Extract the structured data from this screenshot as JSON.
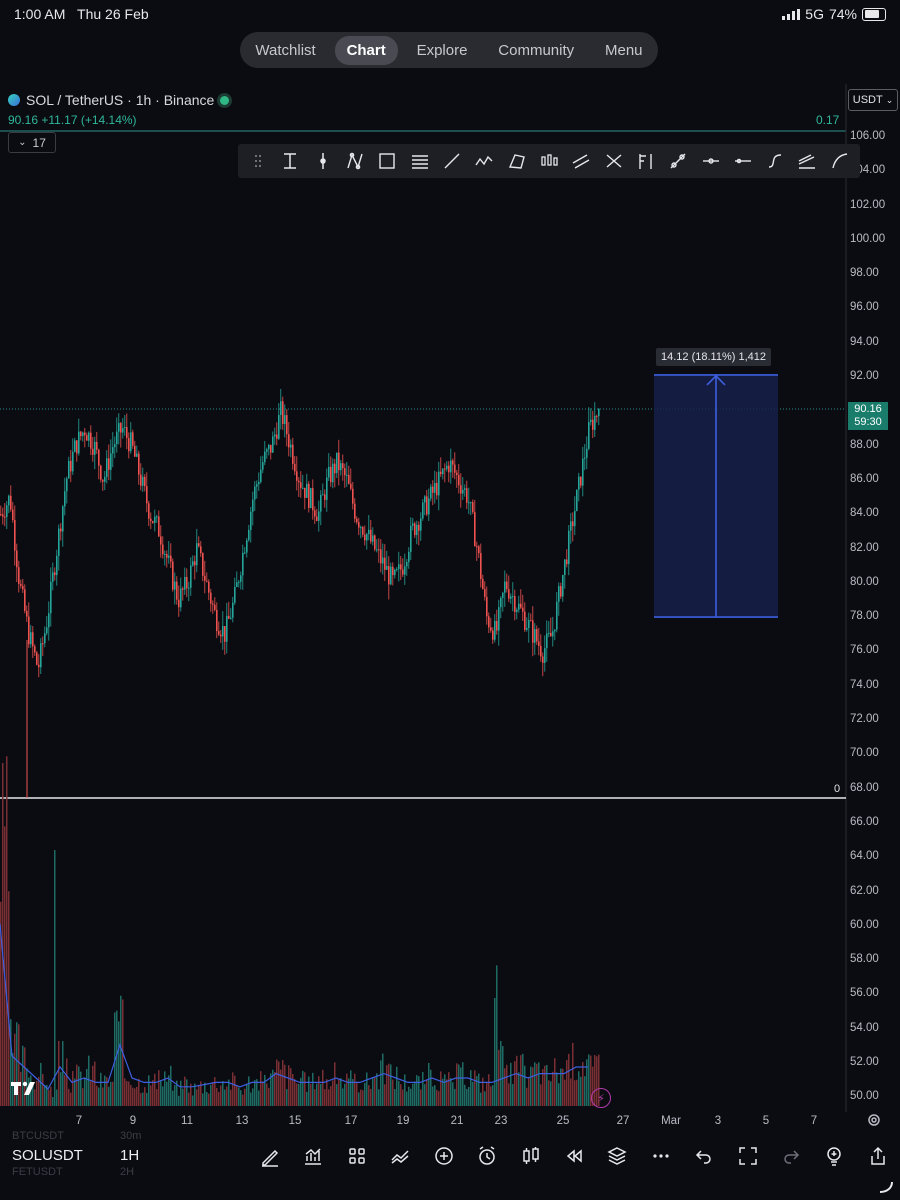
{
  "status": {
    "time": "1:00 AM",
    "date": "Thu 26 Feb",
    "network": "5G",
    "battery": "74%"
  },
  "nav": {
    "tabs": [
      "Watchlist",
      "Chart",
      "Explore",
      "Community",
      "Menu"
    ],
    "active": "Chart"
  },
  "header": {
    "symbol_line": "SOL / TetherUS · 1h · Binance",
    "price_change": "90.16 +11.17 (+14.14%)",
    "right_value": "0.17",
    "interval_value": "17",
    "quote_currency": "USDT"
  },
  "toolbar_icons": [
    "text-cursor-icon",
    "vertical-line-icon",
    "pattern-icon",
    "rectangle-icon",
    "fib-lines-icon",
    "trend-line-icon",
    "wave-icon",
    "polygon-icon",
    "candles-icon",
    "channel-icon",
    "cross-lines-icon",
    "long-position-icon",
    "anchor-icon",
    "path-icon",
    "horizontal-ray-icon",
    "horizontal-line-icon",
    "curve-icon",
    "regression-icon",
    "arc-icon"
  ],
  "axis": {
    "y_ticks": [
      "106.00",
      "104.00",
      "102.00",
      "100.00",
      "98.00",
      "96.00",
      "94.00",
      "92.00",
      "88.00",
      "86.00",
      "84.00",
      "82.00",
      "80.00",
      "78.00",
      "76.00",
      "74.00",
      "72.00",
      "70.00",
      "68.00",
      "66.00",
      "64.00",
      "62.00",
      "60.00",
      "58.00",
      "56.00",
      "54.00",
      "52.00",
      "50.00"
    ],
    "x_ticks": [
      "7",
      "9",
      "11",
      "13",
      "15",
      "17",
      "19",
      "21",
      "23",
      "25",
      "27",
      "Mar",
      "3",
      "5",
      "7"
    ]
  },
  "price_badge": {
    "price": "90.16",
    "countdown": "59:30"
  },
  "measure": {
    "label": "14.12 (18.11%) 1,412",
    "start": 78.0,
    "end": 92.12
  },
  "pane_separator_value": "0",
  "chart_data": {
    "type": "line",
    "series": [
      {
        "values": [
          84,
          85,
          80,
          77,
          75,
          78,
          82,
          86,
          88,
          89,
          88,
          86,
          88,
          89,
          88,
          86,
          84,
          83,
          81,
          79,
          80,
          82,
          80,
          78,
          77,
          79,
          82,
          85,
          87,
          88,
          90,
          88,
          86,
          85,
          84,
          86,
          87,
          86,
          84,
          83,
          82,
          81,
          80,
          81,
          83,
          84,
          85,
          86,
          87,
          86,
          85,
          82,
          78,
          77,
          80,
          79,
          78,
          77,
          76,
          77,
          80,
          83,
          86,
          89,
          90.16
        ]
      }
    ],
    "current_price": 90.16,
    "ylim": [
      50,
      106
    ],
    "volume": [
      80,
      20,
      15,
      10,
      10,
      5,
      15,
      8,
      10,
      12,
      8,
      8,
      25,
      10,
      8,
      8,
      8,
      10,
      6,
      8,
      6,
      7,
      8,
      8,
      8,
      6,
      8,
      8,
      10,
      12,
      10,
      8,
      8,
      10,
      8,
      10,
      8,
      8,
      8,
      10,
      12,
      10,
      8,
      8,
      8,
      10,
      8,
      8,
      10,
      10,
      8,
      8,
      35,
      10,
      12,
      10,
      12,
      10,
      12,
      12,
      15,
      15,
      12,
      15
    ]
  },
  "bottom": {
    "ticker_above": "BTCUSDT",
    "tf_above": "30m",
    "ticker": "SOLUSDT",
    "timeframe": "1H",
    "ticker_below": "FETUSDT",
    "tf_below": "2H",
    "icons": [
      "draw-icon",
      "indicators-icon",
      "layouts-icon",
      "compare-icon",
      "add-icon",
      "alert-icon",
      "candle-type-icon",
      "replay-icon",
      "layers-icon",
      "more-icon",
      "undo-icon",
      "fullscreen-icon",
      "redo-icon",
      "ideas-icon",
      "share-icon"
    ]
  }
}
